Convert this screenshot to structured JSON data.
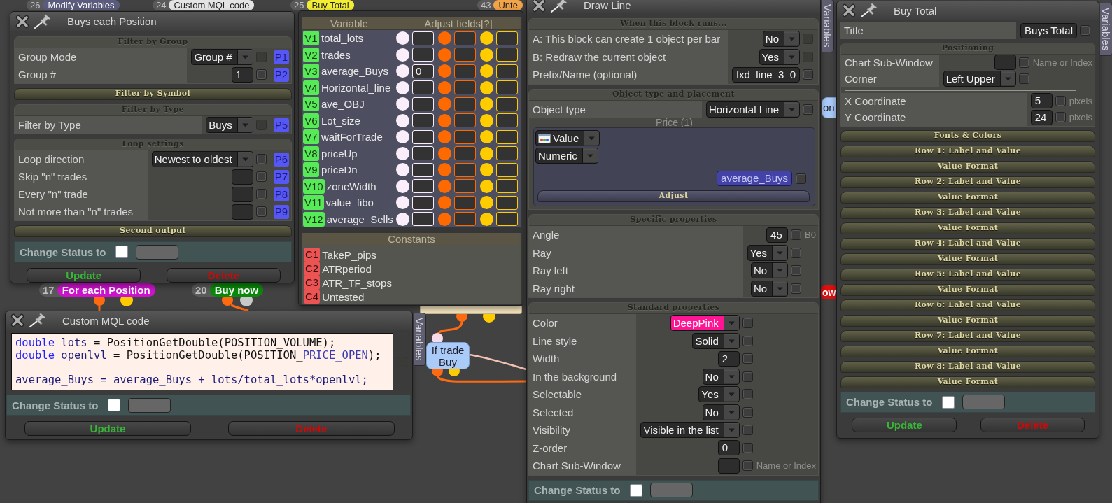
{
  "canvas": {
    "nodes": [
      {
        "kind": "block",
        "number": "26",
        "label": "Modify Variables",
        "color": "#5b5b7d"
      },
      {
        "kind": "block",
        "number": "24",
        "label": "Custom MQL code",
        "color": "#e4e4e4"
      },
      {
        "kind": "block",
        "number": "25",
        "label": "Buy Total",
        "color": "#f4ee32"
      },
      {
        "kind": "block",
        "number": "43",
        "label": "Unte",
        "color": "#f3a348"
      },
      {
        "kind": "block",
        "number": "17",
        "label": "For each Position",
        "color": "#cc12cc"
      },
      {
        "kind": "block",
        "number": "20",
        "label": "Buy now",
        "color": "#0a880a"
      },
      {
        "kind": "stub",
        "color": "#f1e1bd"
      },
      {
        "kind": "condition",
        "label": "If trade Buy",
        "color": "#aacbf8"
      },
      {
        "kind": "condition",
        "label": "on",
        "color": "#aacbf8"
      },
      {
        "kind": "block",
        "label": "ow",
        "color": "#de1010"
      }
    ]
  },
  "windows": [
    {
      "kind": "properties",
      "title": "Buys each Position",
      "sections": [
        {
          "title": "Filter by Group",
          "expanded": true,
          "rows": [
            {
              "kind": "property",
              "label": "Group Mode",
              "control": {
                "kind": "dropdown",
                "value": "Group #"
              },
              "checkbox": {
                "checked": false,
                "disabled": true
              },
              "badge": "P1"
            },
            {
              "kind": "property",
              "label": "Group #",
              "control": {
                "kind": "field",
                "value": "1"
              },
              "checkbox": {
                "checked": false,
                "disabled": false
              },
              "badge": "P2"
            }
          ]
        },
        {
          "title": "Filter by Symbol",
          "expanded": false
        },
        {
          "title": "Filter by Type",
          "expanded": true,
          "rows": [
            {
              "kind": "property",
              "label": "Filter by Type",
              "control": {
                "kind": "dropdown",
                "value": "Buys"
              },
              "checkbox": {
                "checked": false,
                "disabled": true
              },
              "badge": "P5"
            }
          ]
        },
        {
          "title": "Loop settings",
          "expanded": true,
          "rows": [
            {
              "kind": "property",
              "label": "Loop direction",
              "control": {
                "kind": "dropdown",
                "value": "Newest to oldest"
              },
              "checkbox": {
                "checked": false,
                "disabled": false
              },
              "badge": "P6"
            },
            {
              "kind": "property",
              "label": "Skip \"n\" trades",
              "control": {
                "kind": "field"
              },
              "checkbox": {
                "checked": false,
                "disabled": false
              },
              "badge": "P7"
            },
            {
              "kind": "property",
              "label": "Every \"n\" trade",
              "control": {
                "kind": "field"
              },
              "checkbox": {
                "checked": false,
                "disabled": false
              },
              "badge": "P8"
            },
            {
              "kind": "property",
              "label": "Not more than \"n\" trades",
              "control": {
                "kind": "field"
              },
              "checkbox": {
                "checked": false,
                "disabled": false
              },
              "badge": "P9"
            }
          ]
        },
        {
          "title": "Second output",
          "expanded": false
        }
      ],
      "status": {
        "label": "Change Status to",
        "checked": false
      },
      "buttons": [
        {
          "kind": "update",
          "label": "Update"
        },
        {
          "kind": "delete",
          "label": "Delete"
        }
      ]
    },
    {
      "kind": "variables",
      "headers": [
        "Variable",
        "Adjust fields[?]"
      ],
      "adjust_columns": [
        {
          "color": "#fbeefb"
        },
        {
          "color": "#ff6a00"
        },
        {
          "color": "#ffcc00"
        }
      ],
      "variables": [
        {
          "badge": "V1",
          "name": "total_lots"
        },
        {
          "badge": "V2",
          "name": "trades"
        },
        {
          "badge": "V3",
          "name": "average_Buys",
          "value": "0"
        },
        {
          "badge": "V4",
          "name": "Horizontal_line"
        },
        {
          "badge": "V5",
          "name": "ave_OBJ"
        },
        {
          "badge": "V6",
          "name": "Lot_size"
        },
        {
          "badge": "V7",
          "name": "waitForTrade"
        },
        {
          "badge": "V8",
          "name": "priceUp"
        },
        {
          "badge": "V9",
          "name": "priceDn"
        },
        {
          "badge": "V10",
          "name": "zoneWidth"
        },
        {
          "badge": "V11",
          "name": "value_fibo"
        },
        {
          "badge": "V12",
          "name": "average_Sells"
        }
      ],
      "constants_title": "Constants",
      "constants": [
        {
          "badge": "C1",
          "name": "TakeP_pips"
        },
        {
          "badge": "C2",
          "name": "ATRperiod"
        },
        {
          "badge": "C3",
          "name": "ATR_TF_stops"
        },
        {
          "badge": "C4",
          "name": "Untested"
        }
      ]
    },
    {
      "kind": "code",
      "title": "Custom MQL code",
      "variables_tab": "Variables",
      "code": {
        "lines": [
          {
            "kind": "code",
            "tokens": [
              {
                "kind": "keyword",
                "text": "double"
              },
              {
                "kind": "variable",
                "text": " lots"
              },
              {
                "kind": "plain",
                "text": " = PositionGetDouble(POSITION_VOLUME);"
              }
            ]
          },
          {
            "kind": "code",
            "tokens": [
              {
                "kind": "keyword",
                "text": "double"
              },
              {
                "kind": "variable",
                "text": " openlvl"
              },
              {
                "kind": "plain",
                "text": " = PositionGetDouble(POSITION_"
              },
              {
                "kind": "constant",
                "text": "PRICE_OPEN"
              },
              {
                "kind": "plain",
                "text": ");"
              }
            ]
          },
          {
            "kind": "blank"
          },
          {
            "kind": "code",
            "tokens": [
              {
                "kind": "variable",
                "text": "average_Buys = average_Buys + lots/total_lots*openlvl;"
              }
            ]
          }
        ],
        "checkbox": {
          "checked": false,
          "disabled": true
        }
      },
      "status": {
        "label": "Change Status to",
        "checked": false
      },
      "buttons": [
        {
          "kind": "update",
          "label": "Update"
        },
        {
          "kind": "delete",
          "label": "Delete"
        }
      ]
    },
    {
      "kind": "properties",
      "title": "Draw Line",
      "variables_tab": "Variables",
      "sections": [
        {
          "title": "When this block runs...",
          "expanded": true,
          "rows": [
            {
              "kind": "property",
              "label": "A: This block can create 1 object per bar",
              "control": {
                "kind": "dropdown",
                "value": "No"
              },
              "checkbox": {
                "checked": false,
                "disabled": true
              }
            },
            {
              "kind": "property",
              "label": "B: Redraw the current object",
              "control": {
                "kind": "dropdown",
                "value": "Yes"
              },
              "checkbox": {
                "checked": false,
                "disabled": true
              }
            },
            {
              "kind": "property",
              "label": "Prefix/Name (optional)",
              "control": {
                "kind": "field",
                "value": "fxd_line_3_0"
              },
              "checkbox": {
                "checked": false,
                "disabled": false
              }
            }
          ]
        },
        {
          "title": "Object type and placement",
          "expanded": true,
          "rows": [
            {
              "kind": "property",
              "label": "Object type",
              "control": {
                "kind": "dropdown",
                "value": "Horizontal Line"
              },
              "checkbox": {
                "checked": false,
                "disabled": false
              }
            },
            {
              "kind": "input_group",
              "title": "Price (1)",
              "selectors": [
                {
                  "kind": "source_dropdown",
                  "value": "Value"
                },
                {
                  "kind": "dropdown",
                  "value": "Numeric"
                }
              ],
              "tag": "average_Buys",
              "checkbox": {
                "checked": false,
                "disabled": false
              },
              "footer": "Adjust"
            }
          ]
        },
        {
          "title": "Specific properties",
          "expanded": true,
          "rows": [
            {
              "kind": "property",
              "label": "Angle",
              "control": {
                "kind": "field",
                "value": "45"
              },
              "checkbox": {
                "checked": false,
                "disabled": false
              },
              "note": "B0"
            },
            {
              "kind": "property",
              "label": "Ray",
              "control": {
                "kind": "dropdown",
                "value": "Yes"
              },
              "checkbox": {
                "checked": false,
                "disabled": false
              }
            },
            {
              "kind": "property",
              "label": "Ray left",
              "control": {
                "kind": "dropdown",
                "value": "No"
              },
              "checkbox": {
                "checked": false,
                "disabled": false
              }
            },
            {
              "kind": "property",
              "label": "Ray right",
              "control": {
                "kind": "dropdown",
                "value": "No"
              },
              "checkbox": {
                "checked": false,
                "disabled": false
              }
            }
          ]
        },
        {
          "title": "Standard properties",
          "expanded": true,
          "rows": [
            {
              "kind": "property",
              "label": "Color",
              "control": {
                "kind": "dropdown",
                "value": "DeepPink",
                "color": "#ff1493"
              },
              "checkbox": {
                "checked": false,
                "disabled": false
              }
            },
            {
              "kind": "property",
              "label": "Line style",
              "control": {
                "kind": "dropdown",
                "value": "Solid"
              },
              "checkbox": {
                "checked": false,
                "disabled": false
              }
            },
            {
              "kind": "property",
              "label": "Width",
              "control": {
                "kind": "field",
                "value": "2"
              },
              "checkbox": {
                "checked": false,
                "disabled": false
              }
            },
            {
              "kind": "property",
              "label": "In the background",
              "control": {
                "kind": "dropdown",
                "value": "No"
              },
              "checkbox": {
                "checked": false,
                "disabled": false
              }
            },
            {
              "kind": "property",
              "label": "Selectable",
              "control": {
                "kind": "dropdown",
                "value": "Yes"
              },
              "checkbox": {
                "checked": false,
                "disabled": false
              }
            },
            {
              "kind": "property",
              "label": "Selected",
              "control": {
                "kind": "dropdown",
                "value": "No"
              },
              "checkbox": {
                "checked": false,
                "disabled": false
              }
            },
            {
              "kind": "property",
              "label": "Visibility",
              "control": {
                "kind": "dropdown",
                "value": "Visible in the list"
              },
              "checkbox": {
                "checked": false,
                "disabled": false
              }
            },
            {
              "kind": "property",
              "label": "Z-order",
              "control": {
                "kind": "field",
                "value": "0"
              },
              "checkbox": {
                "checked": false,
                "disabled": false
              }
            },
            {
              "kind": "property",
              "label": "Chart Sub-Window",
              "control": {
                "kind": "field"
              },
              "checkbox": {
                "checked": false,
                "disabled": false
              },
              "note": "Name or Index"
            }
          ]
        }
      ],
      "status": {
        "label": "Change Status to",
        "checked": false
      }
    },
    {
      "kind": "properties",
      "title": "Buy Total",
      "variables_tab": "Variables",
      "sections": [
        {
          "rows": [
            {
              "kind": "property",
              "label": "Title",
              "control": {
                "kind": "field",
                "value": "Buys Total"
              },
              "checkbox": {
                "checked": false,
                "disabled": false
              }
            }
          ]
        },
        {
          "title": "Positioning",
          "expanded": true,
          "row_groups": [
            [
              {
                "kind": "property",
                "label": "Chart Sub-Window",
                "control": {
                  "kind": "field"
                },
                "checkbox": {
                  "checked": false,
                  "disabled": false
                },
                "note": "Name or Index"
              },
              {
                "kind": "property",
                "label": "Corner",
                "control": {
                  "kind": "dropdown",
                  "value": "Left Upper"
                },
                "checkbox": {
                  "checked": false,
                  "disabled": false
                }
              }
            ],
            [
              {
                "kind": "property",
                "label": "X Coordinate",
                "control": {
                  "kind": "field",
                  "value": "5"
                },
                "checkbox": {
                  "checked": false,
                  "disabled": false
                },
                "note": "pixels"
              },
              {
                "kind": "property",
                "label": "Y Coordinate",
                "control": {
                  "kind": "field",
                  "value": "24"
                },
                "checkbox": {
                  "checked": false,
                  "disabled": false
                },
                "note": "pixels"
              }
            ]
          ]
        },
        {
          "title": "Fonts & Colors",
          "expanded": false
        },
        {
          "title": "Row 1: Label and Value",
          "expanded": false
        },
        {
          "title": "Value Format",
          "expanded": false
        },
        {
          "title": "Row 2: Label and Value",
          "expanded": false
        },
        {
          "title": "Value Format",
          "expanded": false
        },
        {
          "title": "Row 3: Label and Value",
          "expanded": false
        },
        {
          "title": "Value Format",
          "expanded": false
        },
        {
          "title": "Row 4: Label and Value",
          "expanded": false
        },
        {
          "title": "Value Format",
          "expanded": false
        },
        {
          "title": "Row 5: Label and Value",
          "expanded": false
        },
        {
          "title": "Value Format",
          "expanded": false
        },
        {
          "title": "Row 6: Label and Value",
          "expanded": false
        },
        {
          "title": "Value Format",
          "expanded": false
        },
        {
          "title": "Row 7: Label and Value",
          "expanded": false
        },
        {
          "title": "Value Format",
          "expanded": false
        },
        {
          "title": "Row 8: Label and Value",
          "expanded": false
        },
        {
          "title": "Value Format",
          "expanded": false
        }
      ],
      "status": {
        "label": "Change Status to",
        "checked": false
      },
      "buttons": [
        {
          "kind": "update",
          "label": "Update"
        },
        {
          "kind": "delete",
          "label": "Delete"
        }
      ]
    }
  ]
}
